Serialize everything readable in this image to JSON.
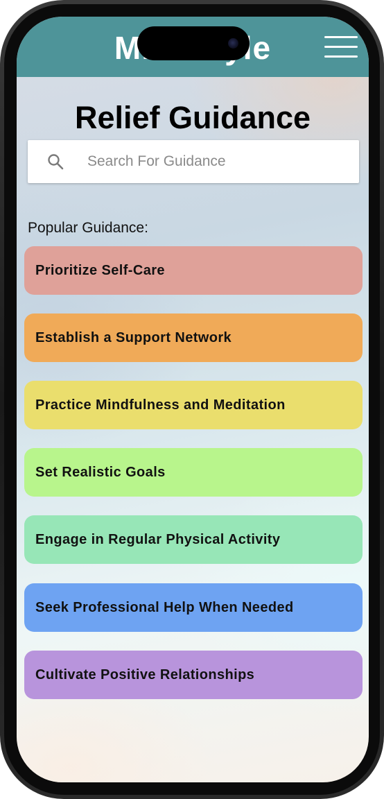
{
  "app": {
    "title": "MindStyle"
  },
  "page": {
    "title": "Relief Guidance"
  },
  "search": {
    "placeholder": "Search For Guidance",
    "value": ""
  },
  "popular": {
    "label": "Popular Guidance:",
    "items": [
      {
        "label": "Prioritize Self-Care",
        "color": "#dfa199"
      },
      {
        "label": "Establish a Support Network",
        "color": "#f0aa58"
      },
      {
        "label": "Practice Mindfulness and Meditation",
        "color": "#eade6d"
      },
      {
        "label": "Set Realistic Goals",
        "color": "#b8f58c"
      },
      {
        "label": "Engage in Regular Physical Activity",
        "color": "#97e6b7"
      },
      {
        "label": "Seek Professional Help When Needed",
        "color": "#6ea3f2"
      },
      {
        "label": "Cultivate Positive Relationships",
        "color": "#b894dc"
      }
    ]
  },
  "icons": {
    "search": "search-icon",
    "menu": "hamburger-menu-icon"
  },
  "colors": {
    "header": "#4e9499",
    "header_text": "#ffffff"
  }
}
